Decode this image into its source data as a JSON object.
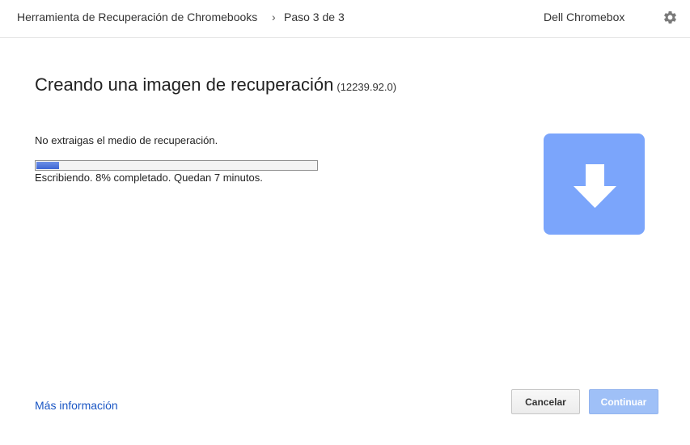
{
  "header": {
    "app_title": "Herramienta de Recuperación de Chromebooks",
    "separator": "›",
    "step": "Paso 3 de 3",
    "device": "Dell Chromebox",
    "settings_icon": "gear-icon"
  },
  "main": {
    "title": "Creando una imagen de recuperación",
    "version": "(12239.92.0)",
    "warning": "No extraigas el medio de recuperación.",
    "progress": {
      "percent": 8,
      "status": "Escribiendo. 8% completado. Quedan 7 minutos."
    },
    "illustration_icon": "download-arrow-icon"
  },
  "footer": {
    "more_info": "Más información",
    "cancel_label": "Cancelar",
    "continue_label": "Continuar"
  },
  "colors": {
    "accent": "#7ba5fb",
    "progress": "#3e66d4",
    "link": "#1a56c4",
    "disabled_button": "#9fc0f7"
  }
}
